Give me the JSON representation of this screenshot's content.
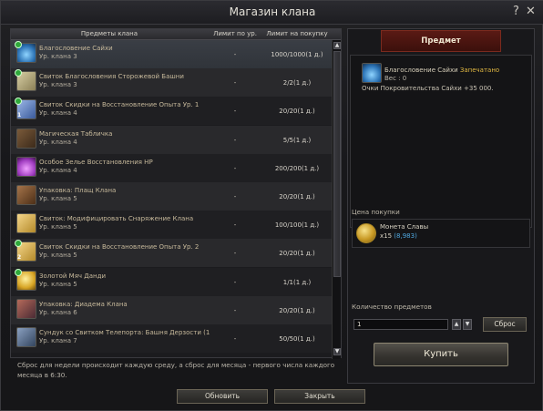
{
  "window": {
    "title": "Магазин клана",
    "help_label": "?",
    "close_label": "✕"
  },
  "list": {
    "headers": {
      "name": "Предметы клана",
      "limit_level": "Лимит по ур.",
      "limit_buy": "Лимит на покупку"
    },
    "items": [
      {
        "name": "Благословение Сайхи",
        "level": "Ур. клана 3",
        "limit_level": "-",
        "limit_buy": "1000/1000(1 д.)",
        "icon": "blue-potion-icon",
        "badge": true,
        "lvl_mark": ""
      },
      {
        "name": "Свиток Благословения Сторожевой Башни",
        "level": "Ур. клана 3",
        "limit_level": "-",
        "limit_buy": "2/2(1 д.)",
        "icon": "scroll-icon",
        "badge": true,
        "lvl_mark": ""
      },
      {
        "name": "Свиток Скидки на Восстановление Опыта Ур. 1",
        "level": "Ур. клана 4",
        "limit_level": "-",
        "limit_buy": "20/20(1 д.)",
        "icon": "blue-scroll-icon",
        "badge": true,
        "lvl_mark": "1"
      },
      {
        "name": "Магическая Табличка",
        "level": "Ур. клана 4",
        "limit_level": "-",
        "limit_buy": "5/5(1 д.)",
        "icon": "tablet-icon",
        "badge": false,
        "lvl_mark": ""
      },
      {
        "name": "Особое Зелье Восстановления HP",
        "level": "Ур. клана 4",
        "limit_level": "-",
        "limit_buy": "200/200(1 д.)",
        "icon": "purple-potion-icon",
        "badge": false,
        "lvl_mark": ""
      },
      {
        "name": "Упаковка: Плащ Клана",
        "level": "Ур. клана 5",
        "limit_level": "-",
        "limit_buy": "20/20(1 д.)",
        "icon": "package-icon",
        "badge": false,
        "lvl_mark": ""
      },
      {
        "name": "Свиток: Модифицировать Снаряжение Клана",
        "level": "Ур. клана 5",
        "limit_level": "-",
        "limit_buy": "100/100(1 д.)",
        "icon": "gold-scroll-icon",
        "badge": false,
        "lvl_mark": ""
      },
      {
        "name": "Свиток Скидки на Восстановление Опыта Ур. 2",
        "level": "Ур. клана 5",
        "limit_level": "-",
        "limit_buy": "20/20(1 д.)",
        "icon": "gold-scroll-icon",
        "badge": true,
        "lvl_mark": "2"
      },
      {
        "name": "Золотой Мяч Данди",
        "level": "Ур. клана 5",
        "limit_level": "-",
        "limit_buy": "1/1(1 д.)",
        "icon": "gold-ball-icon",
        "badge": true,
        "lvl_mark": ""
      },
      {
        "name": "Упаковка: Диадема Клана",
        "level": "Ур. клана 6",
        "limit_level": "-",
        "limit_buy": "20/20(1 д.)",
        "icon": "diadem-icon",
        "badge": false,
        "lvl_mark": ""
      },
      {
        "name": "Сундук со Свитком Телепорта: Башня Дерзости (1",
        "level": "Ур. клана 7",
        "limit_level": "-",
        "limit_buy": "50/50(1 д.)",
        "icon": "chest-icon",
        "badge": false,
        "lvl_mark": ""
      }
    ]
  },
  "reset_note": "Сброс для недели происходит каждую среду, а сброс для месяца - первого числа каждого месяца в 6:30.",
  "buttons": {
    "refresh": "Обновить",
    "close": "Закрыть"
  },
  "detail": {
    "header": "Предмет",
    "item_name": "Благословение Сайхи",
    "sealed": "Запечатано",
    "weight": "Вес : 0",
    "description": "Очки Покровительства Сайхи +35 000.",
    "price_title": "Цена покупки",
    "currency_name": "Монета Славы",
    "currency_count": "x15",
    "currency_owned": "(8,983)",
    "qty_title": "Количество предметов",
    "qty_value": "1",
    "reset_label": "Сброс",
    "buy_label": "Купить"
  },
  "colors": {
    "accent_header": "#5a1a14",
    "sealed": "#e0b742",
    "owned": "#4fa8e0"
  }
}
